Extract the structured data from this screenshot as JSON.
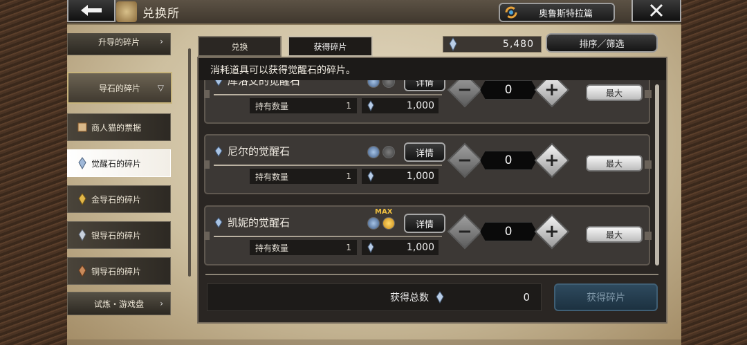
{
  "header": {
    "title": "兑换所",
    "chapter_label": "奥鲁斯特拉篇"
  },
  "sidebar": {
    "items": [
      {
        "label": "升导的碎片",
        "type": "header"
      },
      {
        "label": "导石的碎片",
        "type": "category"
      },
      {
        "label": "商人猫的票据",
        "type": "item"
      },
      {
        "label": "觉醒石的碎片",
        "type": "item",
        "selected": true
      },
      {
        "label": "金导石的碎片",
        "type": "item"
      },
      {
        "label": "银导石的碎片",
        "type": "item"
      },
      {
        "label": "铜导石的碎片",
        "type": "item"
      },
      {
        "label": "试炼・游戏盘",
        "type": "header"
      }
    ]
  },
  "tabs": [
    {
      "label": "兑换",
      "active": false
    },
    {
      "label": "获得碎片",
      "active": true
    }
  ],
  "currency": {
    "value": "5,480"
  },
  "sort_label": "排序／筛选",
  "hint": "消耗道具可以获得觉醒石的碎片。",
  "rows": [
    {
      "name": "库洛艾的觉醒石",
      "max": false,
      "own_label": "持有数量",
      "own_count": "1",
      "price": "1,000",
      "qty": "0",
      "detail": "详情",
      "max_btn": "最大"
    },
    {
      "name": "尼尔的觉醒石",
      "max": false,
      "own_label": "持有数量",
      "own_count": "1",
      "price": "1,000",
      "qty": "0",
      "detail": "详情",
      "max_btn": "最大"
    },
    {
      "name": "凯妮的觉醒石",
      "max": true,
      "max_tag": "MAX",
      "own_label": "持有数量",
      "own_count": "1",
      "price": "1,000",
      "qty": "0",
      "detail": "详情",
      "max_btn": "最大"
    }
  ],
  "footer": {
    "total_label": "获得总数",
    "total_value": "0",
    "get_button": "获得碎片"
  },
  "colors": {
    "accent_gold": "#f0c040",
    "disabled_button": "#2e4a5e",
    "selected_item": "#ffffff"
  }
}
